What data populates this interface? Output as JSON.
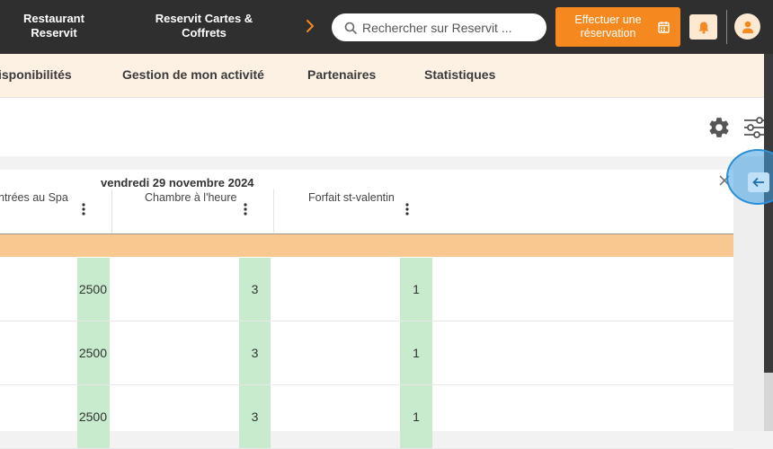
{
  "header": {
    "brand_restaurant": "Restaurant Reservit",
    "brand_cartes": "Reservit Cartes & Coffrets",
    "search_placeholder": "Rechercher sur Reservit ...",
    "cta_label": "Effectuer une réservation",
    "accent_color": "#f5891f"
  },
  "subnav": {
    "items": [
      {
        "label": "isponibilités"
      },
      {
        "label": "Gestion de mon activité"
      },
      {
        "label": "Partenaires"
      },
      {
        "label": "Statistiques"
      }
    ]
  },
  "table": {
    "date_title": "vendredi 29 novembre 2024",
    "columns": [
      {
        "label": "ntrées au Spa"
      },
      {
        "label": "Chambre à l'heure"
      },
      {
        "label": "Forfait st-valentin"
      }
    ],
    "rows": [
      {
        "v1": "2500",
        "v2": "3",
        "v3": "1"
      },
      {
        "v1": "2500",
        "v2": "3",
        "v3": "1"
      },
      {
        "v1": "2500",
        "v2": "3",
        "v3": "1"
      }
    ]
  },
  "icons": {
    "search": "search-icon",
    "calendar": "calendar-icon",
    "bell": "bell-icon",
    "user": "user-icon",
    "chevron": "chevron-right-icon",
    "gear": "gear-icon",
    "sliders": "sliders-icon",
    "close": "close-icon",
    "kebab": "more-vertical-icon",
    "arrow": "arrow-left-icon"
  }
}
